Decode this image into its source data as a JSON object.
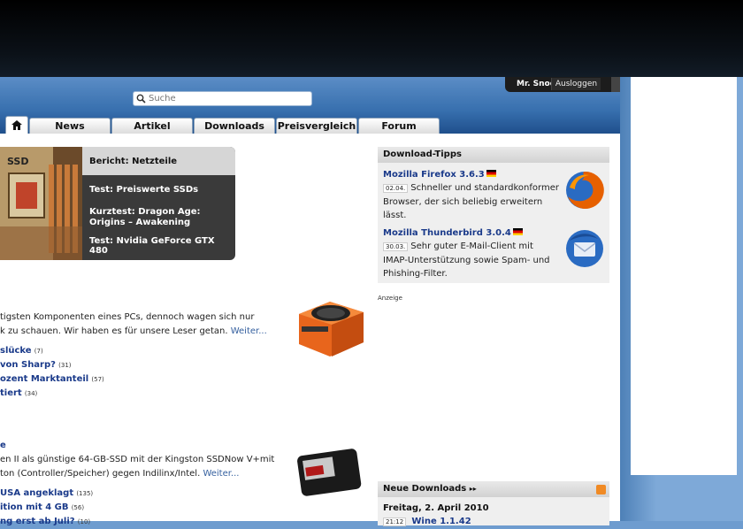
{
  "header": {
    "user_name": "Mr. Snoop",
    "logout_label": "Ausloggen",
    "search_placeholder": "Suche"
  },
  "tabs": [
    {
      "label": "News"
    },
    {
      "label": "Artikel"
    },
    {
      "label": "Downloads"
    },
    {
      "label": "Preisvergleich"
    },
    {
      "label": "Forum"
    }
  ],
  "slider": {
    "items": [
      {
        "label": "Bericht: Netzteile"
      },
      {
        "label": "Test: Preiswerte SSDs"
      },
      {
        "label": "Kurztest: Dragon Age: Origins – Awakening"
      },
      {
        "label": "Test: Nvidia GeForce GTX 480"
      }
    ],
    "image_caption": "SSD"
  },
  "articles": [
    {
      "line1": "tigsten Komponenten eines PCs, dennoch wagen sich nur",
      "line2": "k zu schauen. Wir haben es für unsere Leser getan.",
      "more": "Weiter...",
      "links": [
        {
          "text": "slücke",
          "count": "(7)"
        },
        {
          "text": " von Sharp?",
          "count": "(31)"
        },
        {
          "text": "ozent Marktanteil",
          "count": "(57)"
        },
        {
          "text": "tiert",
          "count": "(34)"
        }
      ]
    },
    {
      "title_fragment": "e",
      "line1": "en II als günstige 64-GB-SSD mit der Kingston SSDNow V+mit",
      "line2": "ton (Controller/Speicher) gegen Indilinx/Intel.",
      "more": "Weiter...",
      "links": [
        {
          "text": "USA angeklagt",
          "count": "(135)"
        },
        {
          "text": "ition mit 4 GB",
          "count": "(56)"
        },
        {
          "text": "ng erst ab Juli?",
          "count": "(10)"
        }
      ]
    }
  ],
  "download_tips": {
    "heading": "Download-Tipps",
    "items": [
      {
        "title": "Mozilla Firefox 3.6.3",
        "date": "02.04.",
        "desc_1": "Schneller und standardkonformer",
        "desc_2": "Browser, der sich beliebig erweitern",
        "desc_3": "lässt."
      },
      {
        "title": "Mozilla Thunderbird 3.0.4",
        "date": "30.03.",
        "desc_1": "Sehr guter E-Mail-Client mit",
        "desc_2": "IMAP-Unterstützung sowie Spam- und",
        "desc_3": "Phishing-Filter."
      }
    ]
  },
  "ad_label": "Anzeige",
  "new_downloads": {
    "heading": "Neue Downloads",
    "day": "Freitag, 2. April 2010",
    "row_date": "21:12",
    "row_title": "Wine 1.1.42"
  },
  "colors": {
    "accent_link": "#1a3a8a",
    "header_blue": "#376fae",
    "firefox_orange": "#e66000",
    "thunderbird_blue": "#2a6bc2"
  }
}
